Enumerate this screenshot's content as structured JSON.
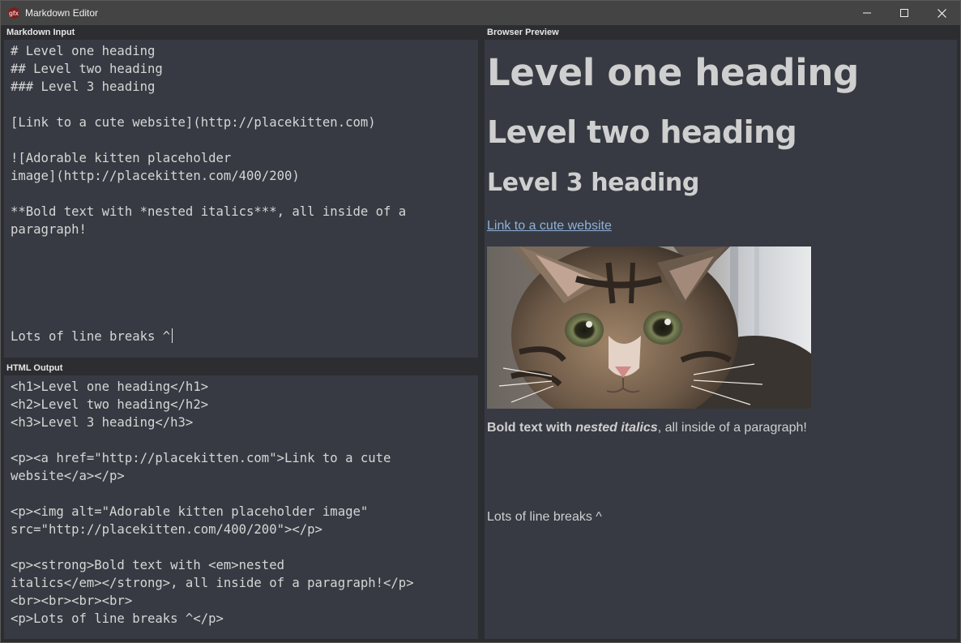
{
  "window": {
    "title": "Markdown Editor",
    "app_icon": "gfx-app-icon",
    "controls": {
      "minimize_icon": "minimize-icon",
      "maximize_icon": "maximize-icon",
      "close_icon": "close-icon"
    }
  },
  "markdown_input": {
    "header": "Markdown Input",
    "lines": [
      "# Level one heading",
      "## Level two heading",
      "### Level 3 heading",
      "",
      "[Link to a cute website](http://placekitten.com)",
      "",
      "![Adorable kitten placeholder",
      "image](http://placekitten.com/400/200)",
      "",
      "**Bold text with *nested italics***, all inside of a",
      "paragraph!",
      "",
      "",
      "",
      "",
      "",
      "Lots of line breaks ^"
    ]
  },
  "html_output": {
    "header": "HTML Output",
    "lines": [
      "<h1>Level one heading</h1>",
      "<h2>Level two heading</h2>",
      "<h3>Level 3 heading</h3>",
      "",
      "<p><a href=\"http://placekitten.com\">Link to a cute",
      "website</a></p>",
      "",
      "<p><img alt=\"Adorable kitten placeholder image\"",
      "src=\"http://placekitten.com/400/200\"></p>",
      "",
      "<p><strong>Bold text with <em>nested",
      "italics</em></strong>, all inside of a paragraph!</p>",
      "<br><br><br><br>",
      "<p>Lots of line breaks ^</p>"
    ]
  },
  "browser_preview": {
    "header": "Browser Preview",
    "h1": "Level one heading",
    "h2": "Level two heading",
    "h3": "Level 3 heading",
    "link_text": "Link to a cute website",
    "image_alt": "Adorable kitten placeholder image",
    "paragraph": {
      "bold_prefix": "Bold text with ",
      "bold_italic": "nested italics",
      "rest": ", all inside of a paragraph!"
    },
    "last_paragraph": "Lots of line breaks ^"
  },
  "colors": {
    "titlebar": "#444444",
    "pane_background": "#373a42",
    "frame_background": "#2b2d31",
    "text": "#d6d6d6",
    "link": "#8fb0d8"
  }
}
